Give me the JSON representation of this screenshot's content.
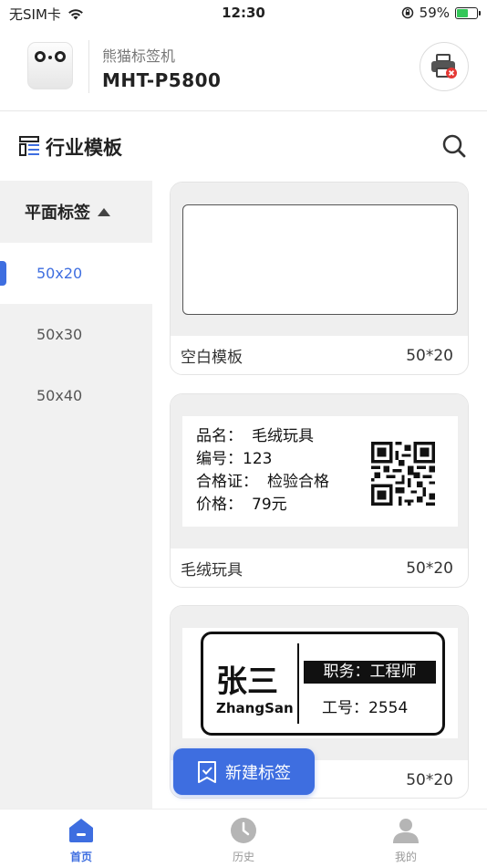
{
  "status_bar": {
    "carrier": "无SIM卡",
    "time": "12:30",
    "battery_percent": "59%",
    "battery_level": 0.59
  },
  "device": {
    "brand": "熊猫标签机",
    "model": "MHT-P5800"
  },
  "title_bar": {
    "title": "行业模板"
  },
  "sidebar": {
    "category": "平面标签",
    "items": [
      {
        "label": "50x20",
        "active": true
      },
      {
        "label": "50x30",
        "active": false
      },
      {
        "label": "50x40",
        "active": false
      }
    ]
  },
  "templates": [
    {
      "name": "空白模板",
      "size": "50*20"
    },
    {
      "name": "毛绒玩具",
      "size": "50*20",
      "lines": [
        {
          "key": "品名：",
          "value": "毛绒玩具"
        },
        {
          "key": "编号：",
          "value": "123"
        },
        {
          "key": "合格证：",
          "value": "检验合格"
        },
        {
          "key": "价格：",
          "value": "79元"
        }
      ]
    },
    {
      "name": "",
      "size": "50*20",
      "badge": {
        "name": "张三",
        "pinyin": "ZhangSan",
        "role": "职务：工程师",
        "employee_no": "工号：2554"
      }
    }
  ],
  "new_button": {
    "label": "新建标签"
  },
  "tabbar": {
    "tabs": [
      {
        "label": "首页",
        "active": true
      },
      {
        "label": "历史",
        "active": false
      },
      {
        "label": "我的",
        "active": false
      }
    ]
  },
  "colors": {
    "accent": "#3e6ee0",
    "sidebar_bg": "#f1f1f1",
    "card_preview_bg": "#efefef",
    "battery_green": "#34c759",
    "error_red": "#e53935"
  }
}
